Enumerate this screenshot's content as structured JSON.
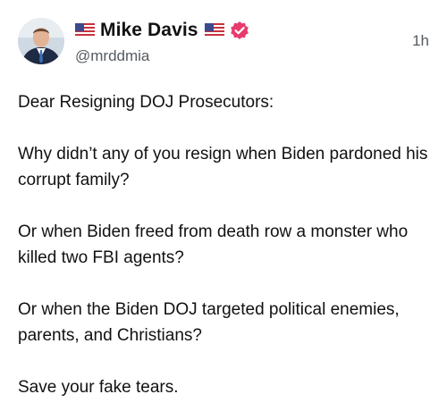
{
  "post": {
    "author": {
      "display_name": "Mike Davis",
      "handle": "@mrddmia",
      "flag_left_icon": "us-flag-icon",
      "flag_right_icon": "us-flag-icon",
      "verified_icon": "verified-badge-icon",
      "verified_color": "#e83a6b"
    },
    "timestamp": "1h",
    "body": [
      "Dear Resigning DOJ Prosecutors:",
      "Why didn’t any of you resign when Biden pardoned his corrupt family?",
      "Or when Biden freed from death row a monster who killed two FBI agents?",
      "Or when the Biden DOJ targeted political enemies, parents, and Christians?",
      "Save your fake tears."
    ]
  }
}
